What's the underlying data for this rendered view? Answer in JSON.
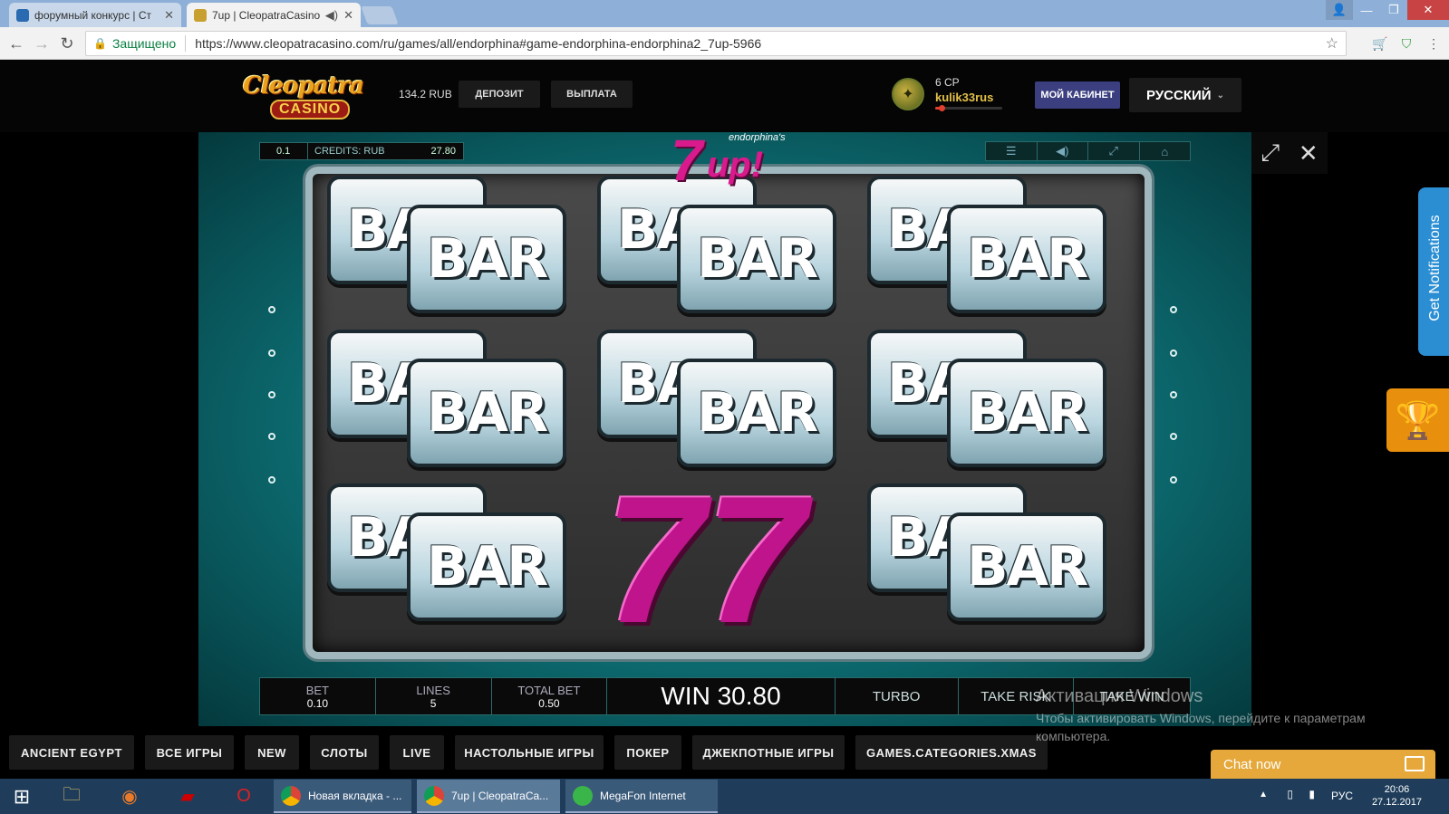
{
  "browser": {
    "tabs": [
      {
        "label": "форумный конкурс | Ст",
        "favicon_color": "#2a6ab0"
      },
      {
        "label": "7up | CleopatraCasino",
        "favicon_color": "#c8a030"
      }
    ],
    "secure_label": "Защищено",
    "url": "https://www.cleopatracasino.com/ru/games/all/endorphina#game-endorphina-endorphina2_7up-5966"
  },
  "header": {
    "logo_top": "Cleopatra",
    "logo_bottom": "CASINO",
    "balance": "134.2 RUB",
    "deposit_label": "ДЕПОЗИТ",
    "withdraw_label": "ВЫПЛАТА",
    "cp": "6 CP",
    "username": "kulik33rus",
    "progress": 0.1,
    "cabinet_label": "МОЙ КАБИНЕТ",
    "language_label": "РУССКИЙ"
  },
  "game": {
    "title_number": "7",
    "title_word": "up!",
    "title_brand": "endorphina's",
    "coin_value": "0.1",
    "credits_label": "CREDITS: RUB",
    "credits_value": "27.80",
    "symbols": [
      [
        "BAR",
        "BAR",
        "BAR"
      ],
      [
        "BAR",
        "BAR",
        "BAR"
      ],
      [
        "BAR",
        "77",
        "BAR"
      ]
    ],
    "bottom": {
      "bet_label": "BET",
      "bet_value": "0.10",
      "lines_label": "LINES",
      "lines_value": "5",
      "total_bet_label": "TOTAL BET",
      "total_bet_value": "0.50",
      "win_label": "WIN 30.80",
      "turbo_label": "TURBO",
      "take_risk_label": "TAKE RISK",
      "take_win_label": "TAKE WIN"
    }
  },
  "side": {
    "notifications_label": "Get Notifications"
  },
  "categories": [
    "ANCIENT EGYPT",
    "ВСЕ ИГРЫ",
    "NEW",
    "СЛОТЫ",
    "LIVE",
    "НАСТОЛЬНЫЕ ИГРЫ",
    "ПОКЕР",
    "ДЖЕКПОТНЫЕ ИГРЫ",
    "GAMES.CATEGORIES.XMAS"
  ],
  "activation": {
    "title": "Активация Windows",
    "subtitle": "Чтобы активировать Windows, перейдите к параметрам компьютера."
  },
  "chat_label": "Chat now",
  "taskbar": {
    "apps": [
      {
        "label": "Новая вкладка - ...",
        "icon_color": "#db4437"
      },
      {
        "label": "7up | CleopatraCa...",
        "icon_color": "#db4437"
      },
      {
        "label": "MegaFon Internet",
        "icon_color": "#3ab54a"
      }
    ],
    "lang": "РУС",
    "time": "20:06",
    "date": "27.12.2017"
  }
}
